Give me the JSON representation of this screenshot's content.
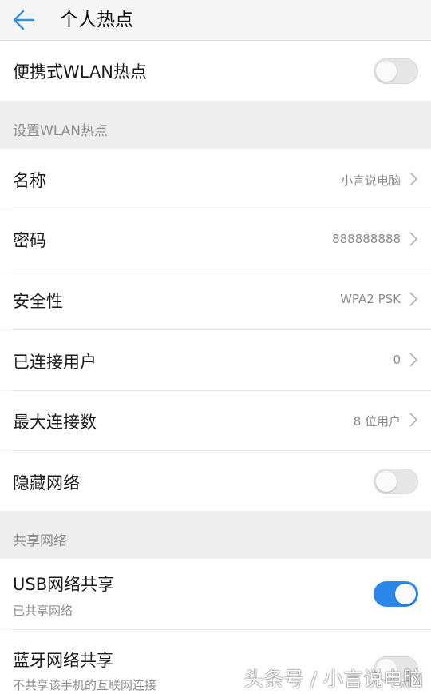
{
  "header": {
    "title": "个人热点",
    "back_icon": "arrow-left-icon"
  },
  "hotspot_toggle": {
    "label": "便携式WLAN热点",
    "enabled": false
  },
  "setup_section": {
    "title": "设置WLAN热点",
    "items": [
      {
        "label": "名称",
        "value": "小言说电脑"
      },
      {
        "label": "密码",
        "value": "888888888"
      },
      {
        "label": "安全性",
        "value": "WPA2 PSK"
      },
      {
        "label": "已连接用户",
        "value": "0"
      },
      {
        "label": "最大连接数",
        "value": "8 位用户"
      }
    ],
    "hide_network": {
      "label": "隐藏网络",
      "enabled": false
    }
  },
  "share_section": {
    "title": "共享网络",
    "usb": {
      "label": "USB网络共享",
      "subtitle": "已共享网络",
      "enabled": true
    },
    "bluetooth": {
      "label": "蓝牙网络共享",
      "subtitle": "不共享该手机的互联网连接",
      "enabled": false
    }
  },
  "watermark": "头条号 / 小言说电脑",
  "colors": {
    "accent": "#2b87ea",
    "back_arrow": "#3b8fd8"
  }
}
